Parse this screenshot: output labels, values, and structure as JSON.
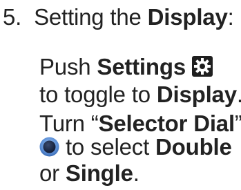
{
  "step": {
    "number": "5.",
    "heading_prefix": "Setting the ",
    "heading_bold": "Display",
    "heading_suffix": ":"
  },
  "settings_instruction": {
    "verb": "Push ",
    "button_name": "Settings",
    "line2_prefix": "to toggle to ",
    "target_mode": "Display",
    "line2_suffix": ".",
    "icon": "gear-icon"
  },
  "dial_instruction": {
    "verb": "Turn “",
    "control_name": "Selector Dial",
    "close_quote": "”",
    "line2_prefix": " to select ",
    "option_1": "Double",
    "conjunction": "or ",
    "option_2": "Single",
    "line3_suffix": ".",
    "icon": "dial-knob-icon"
  },
  "colors": {
    "text": "#222222",
    "gear_icon_fill": "#1f1f1f",
    "dial_center": "#101b35",
    "dial_ring": "#5b8ed6"
  }
}
